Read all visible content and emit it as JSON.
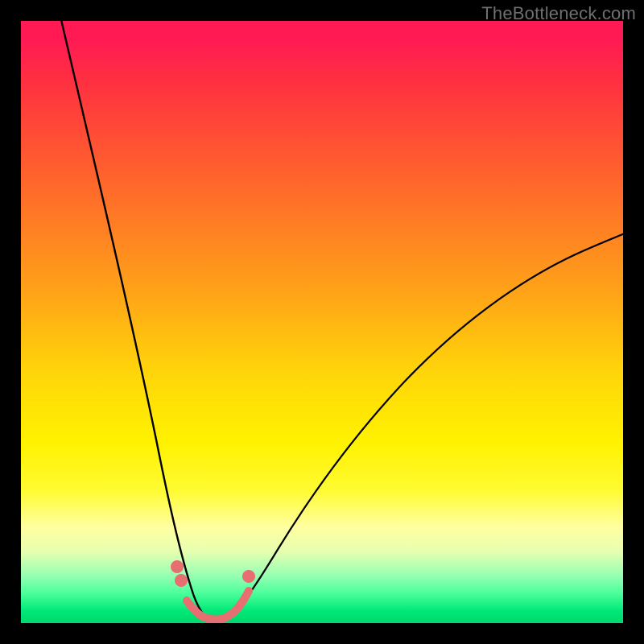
{
  "watermark": {
    "text": "TheBottleneck.com"
  },
  "chart_data": {
    "type": "line",
    "title": "",
    "xlabel": "",
    "ylabel": "",
    "xlim": [
      0,
      100
    ],
    "ylim": [
      0,
      100
    ],
    "gradient_stops": [
      {
        "pct": 0,
        "color": "#ff1a54"
      },
      {
        "pct": 28,
        "color": "#ff6a2a"
      },
      {
        "pct": 58,
        "color": "#ffd40a"
      },
      {
        "pct": 84,
        "color": "#ffffa0"
      },
      {
        "pct": 100,
        "color": "#00d96c"
      }
    ],
    "series": [
      {
        "name": "left-branch",
        "stroke": "#000000",
        "points": [
          {
            "x": 6,
            "y": 100
          },
          {
            "x": 9,
            "y": 86
          },
          {
            "x": 12,
            "y": 72
          },
          {
            "x": 15,
            "y": 58
          },
          {
            "x": 18,
            "y": 44
          },
          {
            "x": 20,
            "y": 33
          },
          {
            "x": 22,
            "y": 22
          },
          {
            "x": 24,
            "y": 13
          },
          {
            "x": 26,
            "y": 6
          },
          {
            "x": 28,
            "y": 2
          },
          {
            "x": 30,
            "y": 0
          }
        ]
      },
      {
        "name": "right-branch",
        "stroke": "#000000",
        "points": [
          {
            "x": 34,
            "y": 0
          },
          {
            "x": 36,
            "y": 3
          },
          {
            "x": 40,
            "y": 9
          },
          {
            "x": 45,
            "y": 17
          },
          {
            "x": 52,
            "y": 27
          },
          {
            "x": 60,
            "y": 36
          },
          {
            "x": 70,
            "y": 46
          },
          {
            "x": 80,
            "y": 54
          },
          {
            "x": 90,
            "y": 60
          },
          {
            "x": 100,
            "y": 65
          }
        ]
      },
      {
        "name": "valley-floor",
        "stroke": "#e76f71",
        "points": [
          {
            "x": 28,
            "y": 2
          },
          {
            "x": 30,
            "y": 0.5
          },
          {
            "x": 32,
            "y": 0.5
          },
          {
            "x": 34,
            "y": 1
          },
          {
            "x": 36,
            "y": 3
          }
        ]
      }
    ],
    "markers": [
      {
        "x": 24.5,
        "y": 10.5,
        "r": 1.1,
        "color": "#e76f71"
      },
      {
        "x": 25.2,
        "y": 8.0,
        "r": 1.1,
        "color": "#e76f71"
      },
      {
        "x": 36.0,
        "y": 8.5,
        "r": 1.1,
        "color": "#e76f71"
      }
    ]
  }
}
